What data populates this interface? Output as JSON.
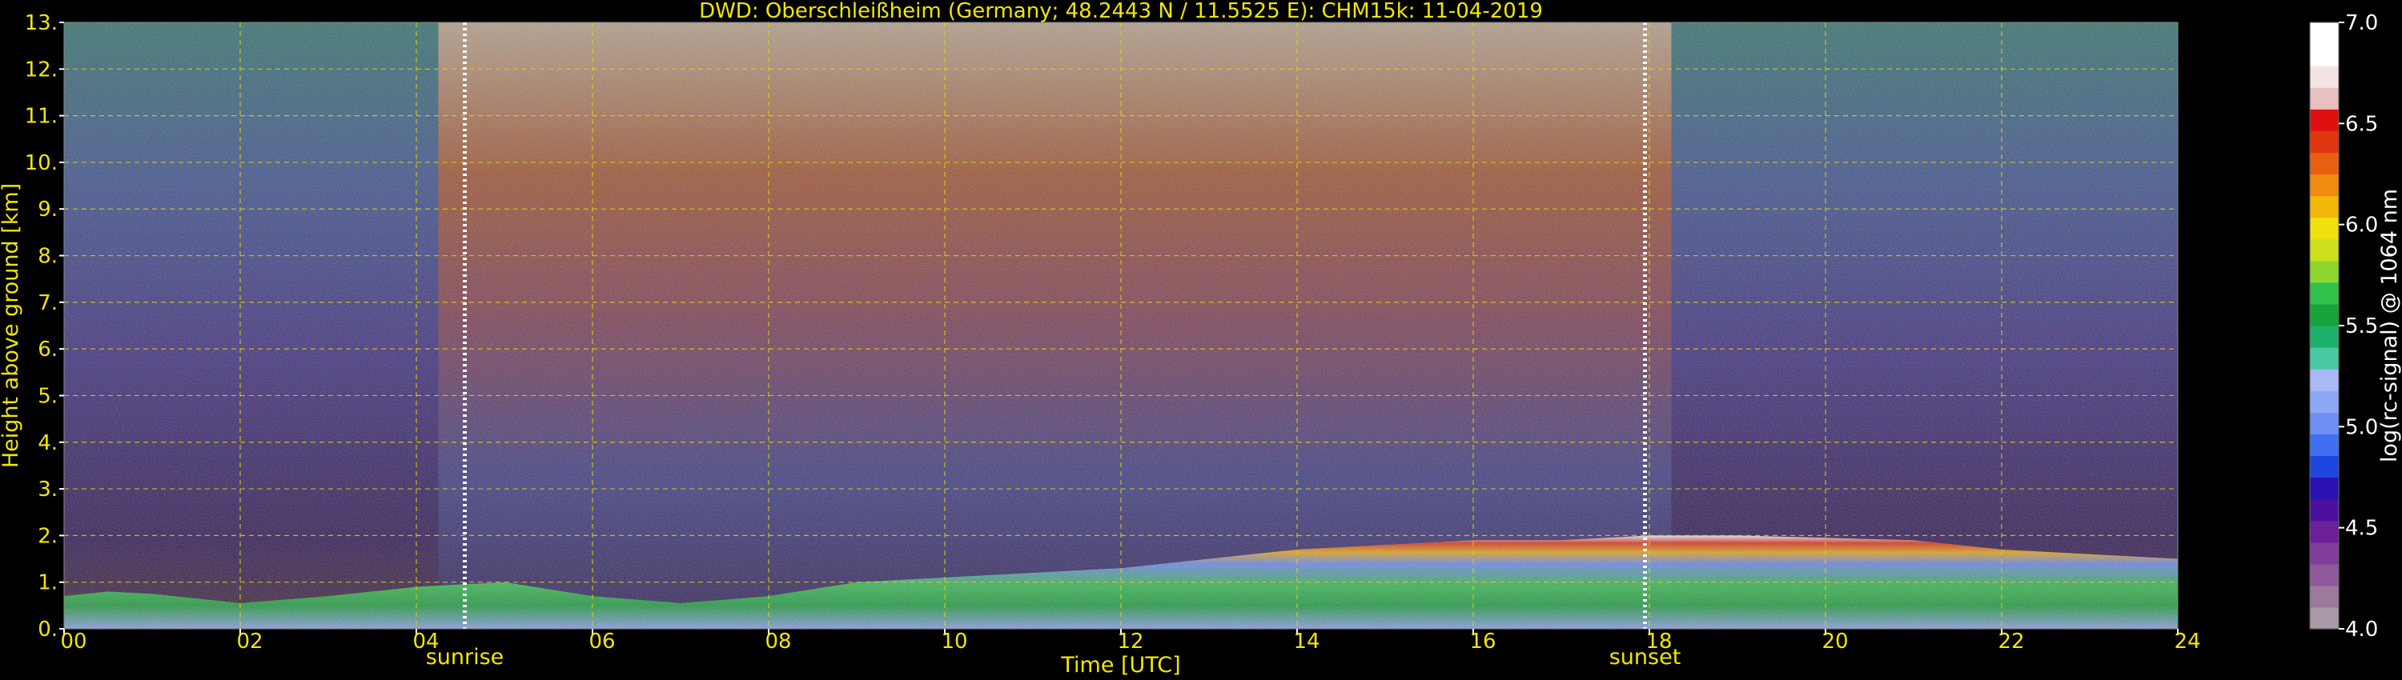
{
  "chart_data": {
    "type": "heatmap",
    "title": "DWD: Oberschleißheim (Germany; 48.2443 N / 11.5525 E):    CHM15k: 11-04-2019",
    "xlabel": "Time [UTC]",
    "ylabel": "Height above ground [km]",
    "xlim": [
      0,
      24
    ],
    "ylim": [
      0,
      13
    ],
    "x_ticks": [
      {
        "value": 0,
        "label": "00"
      },
      {
        "value": 2,
        "label": "02"
      },
      {
        "value": 4,
        "label": "04"
      },
      {
        "value": 6,
        "label": "06"
      },
      {
        "value": 8,
        "label": "08"
      },
      {
        "value": 10,
        "label": "10"
      },
      {
        "value": 12,
        "label": "12"
      },
      {
        "value": 14,
        "label": "14"
      },
      {
        "value": 16,
        "label": "16"
      },
      {
        "value": 18,
        "label": "18"
      },
      {
        "value": 20,
        "label": "20"
      },
      {
        "value": 22,
        "label": "22"
      },
      {
        "value": 24,
        "label": "24"
      }
    ],
    "y_ticks": [
      {
        "value": 0,
        "label": "0."
      },
      {
        "value": 1,
        "label": "1."
      },
      {
        "value": 2,
        "label": "2."
      },
      {
        "value": 3,
        "label": "3."
      },
      {
        "value": 4,
        "label": "4."
      },
      {
        "value": 5,
        "label": "5."
      },
      {
        "value": 6,
        "label": "6."
      },
      {
        "value": 7,
        "label": "7."
      },
      {
        "value": 8,
        "label": "8."
      },
      {
        "value": 9,
        "label": "9."
      },
      {
        "value": 10,
        "label": "10."
      },
      {
        "value": 11,
        "label": "11."
      },
      {
        "value": 12,
        "label": "12."
      },
      {
        "value": 13,
        "label": "13."
      }
    ],
    "grid": true,
    "markers": [
      {
        "time": 4.55,
        "label": "sunrise"
      },
      {
        "time": 17.95,
        "label": "sunset"
      }
    ],
    "boundary_layer_top_km": [
      [
        0,
        0.7
      ],
      [
        0.5,
        0.8
      ],
      [
        1,
        0.75
      ],
      [
        2,
        0.55
      ],
      [
        3,
        0.7
      ],
      [
        4,
        0.9
      ],
      [
        5,
        1.0
      ],
      [
        6,
        0.7
      ],
      [
        7,
        0.55
      ],
      [
        8,
        0.7
      ],
      [
        9,
        1.0
      ],
      [
        10,
        1.1
      ],
      [
        11,
        1.2
      ],
      [
        12,
        1.3
      ],
      [
        13,
        1.5
      ],
      [
        14,
        1.7
      ],
      [
        15,
        1.8
      ],
      [
        16,
        1.9
      ],
      [
        17,
        1.9
      ],
      [
        18,
        2.0
      ],
      [
        19,
        2.0
      ],
      [
        20,
        1.95
      ],
      [
        21,
        1.9
      ],
      [
        22,
        1.7
      ],
      [
        23,
        1.6
      ],
      [
        24,
        1.5
      ]
    ],
    "colorbar": {
      "label": "log(rc-signal) @ 1064 nm",
      "range": [
        4.0,
        7.0
      ],
      "ticks": [
        {
          "value": 4.0,
          "label": "4.0"
        },
        {
          "value": 4.5,
          "label": "4.5"
        },
        {
          "value": 5.0,
          "label": "5.0"
        },
        {
          "value": 5.5,
          "label": "5.5"
        },
        {
          "value": 6.0,
          "label": "6.0"
        },
        {
          "value": 6.5,
          "label": "6.5"
        },
        {
          "value": 7.0,
          "label": "7.0"
        }
      ],
      "colors": [
        "#a89aa8",
        "#9c7a9c",
        "#8f5a9a",
        "#7f3c98",
        "#6b1f99",
        "#4d0fa0",
        "#2a10b0",
        "#1f45e0",
        "#4070f0",
        "#6f8ff5",
        "#8fa8f5",
        "#aab8f5",
        "#48c9a4",
        "#1db06a",
        "#18a33a",
        "#30c24a",
        "#8ed62f",
        "#cce21f",
        "#f0e010",
        "#f2b80a",
        "#f08a10",
        "#e8600f",
        "#e03510",
        "#e01010",
        "#e8c0c0",
        "#f4e4e4",
        "#ffffff",
        "#ffffff"
      ]
    }
  }
}
